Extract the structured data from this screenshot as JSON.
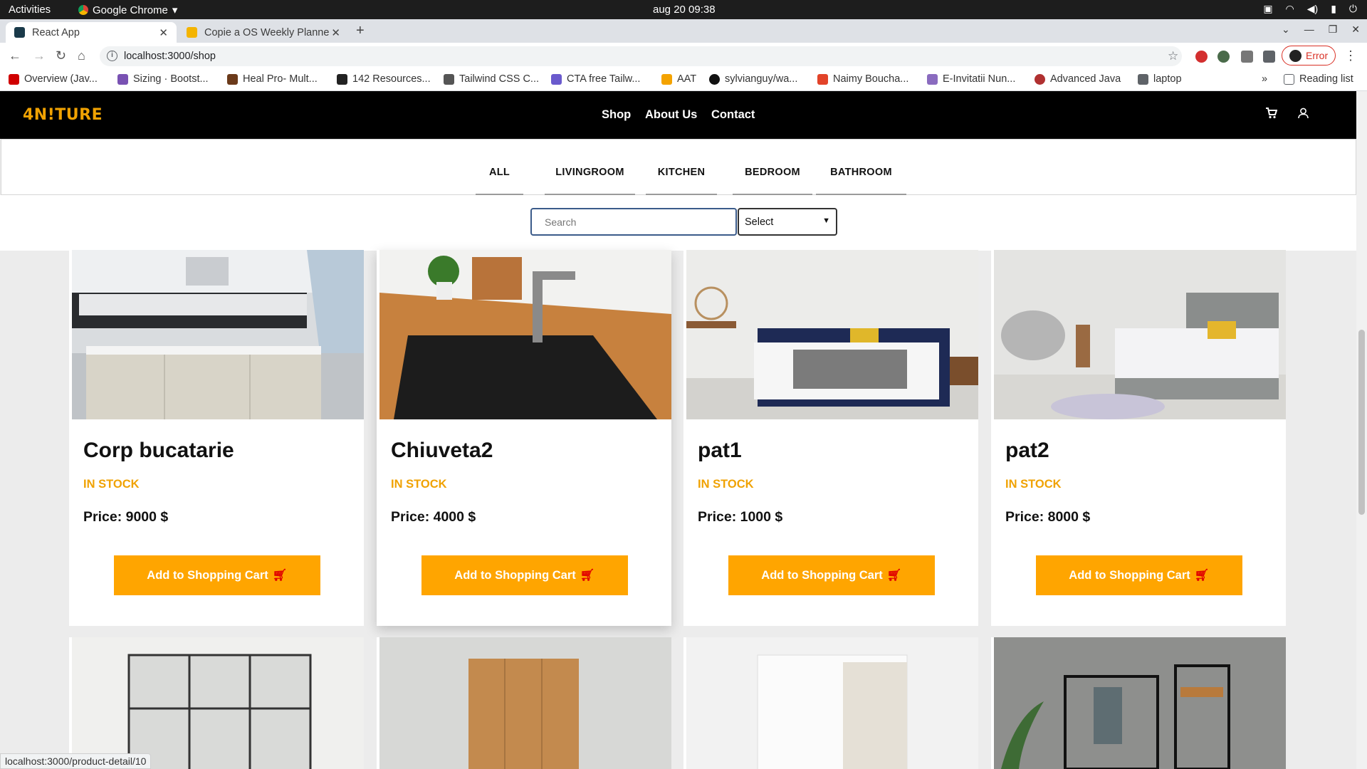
{
  "os": {
    "activities": "Activities",
    "app": "Google Chrome",
    "clock": "aug 20  09:38"
  },
  "tabs": [
    {
      "title": "React App",
      "fav": "#1a3a4a"
    },
    {
      "title": "Copie a OS Weekly Planne",
      "fav": "#f4b400"
    }
  ],
  "address": {
    "url": "localhost:3000/shop"
  },
  "error_label": "Error",
  "bookmarks": [
    {
      "label": "Overview (Jav...",
      "color": "#d00000"
    },
    {
      "label": "Sizing · Bootst...",
      "color": "#7952b3"
    },
    {
      "label": "Heal Pro- Mult...",
      "color": "#6b3a1a"
    },
    {
      "label": "142 Resources...",
      "color": "#222222"
    },
    {
      "label": "Tailwind CSS C...",
      "color": "#555555"
    },
    {
      "label": "CTA free Tailw...",
      "color": "#6a5acd"
    },
    {
      "label": "AAT",
      "color": "#f4a300"
    },
    {
      "label": "sylvianguy/wa...",
      "color": "#111111"
    },
    {
      "label": "Naimy Boucha...",
      "color": "#e24329"
    },
    {
      "label": "E-Invitatii Nun...",
      "color": "#8a6bbf"
    },
    {
      "label": "Advanced Java",
      "color": "#b03030"
    },
    {
      "label": "laptop",
      "color": "#5f6368"
    }
  ],
  "reading_list": "Reading list",
  "site": {
    "logo": "4N!TURE",
    "nav": [
      "Shop",
      "About Us",
      "Contact"
    ]
  },
  "categories": [
    "ALL",
    "LIVINGROOM",
    "KITCHEN",
    "BEDROOM",
    "BATHROOM"
  ],
  "search": {
    "placeholder": "Search",
    "select": "Select"
  },
  "products": [
    {
      "name": "Corp bucatarie",
      "stock": "IN STOCK",
      "price": "Price: 9000 $",
      "button": "Add to Shopping Cart"
    },
    {
      "name": "Chiuveta2",
      "stock": "IN STOCK",
      "price": "Price: 4000 $",
      "button": "Add to Shopping Cart"
    },
    {
      "name": "pat1",
      "stock": "IN STOCK",
      "price": "Price: 1000 $",
      "button": "Add to Shopping Cart"
    },
    {
      "name": "pat2",
      "stock": "IN STOCK",
      "price": "Price: 8000 $",
      "button": "Add to Shopping Cart"
    }
  ],
  "status_url": "localhost:3000/product-detail/10"
}
